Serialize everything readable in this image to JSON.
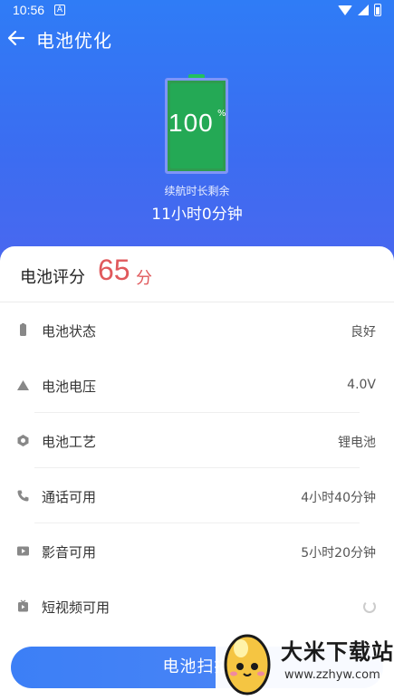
{
  "status_bar": {
    "time": "10:56",
    "notification_icon": "A"
  },
  "header": {
    "title": "电池优化"
  },
  "battery": {
    "level": "100",
    "unit": "%",
    "remain_label": "续航时长剩余",
    "remain_value": "11小时0分钟",
    "fill_percent": 100,
    "colors": {
      "fill": "#24a955",
      "frame": "#7f95f7"
    }
  },
  "score": {
    "label": "电池评分",
    "value": "65",
    "unit": "分",
    "color": "#e0595c"
  },
  "info_rows": [
    {
      "icon": "battery-icon",
      "label": "电池状态",
      "value": "良好"
    },
    {
      "icon": "triangle-icon",
      "label": "电池电压",
      "value": "4.0V"
    },
    {
      "icon": "hexagon-icon",
      "label": "电池工艺",
      "value": "锂电池"
    },
    {
      "icon": "phone-icon",
      "label": "通话可用",
      "value": "4小时40分钟"
    },
    {
      "icon": "video-icon",
      "label": "影音可用",
      "value": "5小时20分钟"
    },
    {
      "icon": "short-video-icon",
      "label": "短视频可用",
      "value": ""
    }
  ],
  "scan_button": {
    "label": "电池扫描"
  },
  "watermark": {
    "title": "大米下载站",
    "url": "www.zzhyw.com"
  },
  "theme": {
    "accent": "#3c7ff6",
    "hero_top": "#2f7cf6",
    "hero_bottom": "#4a67ef"
  }
}
